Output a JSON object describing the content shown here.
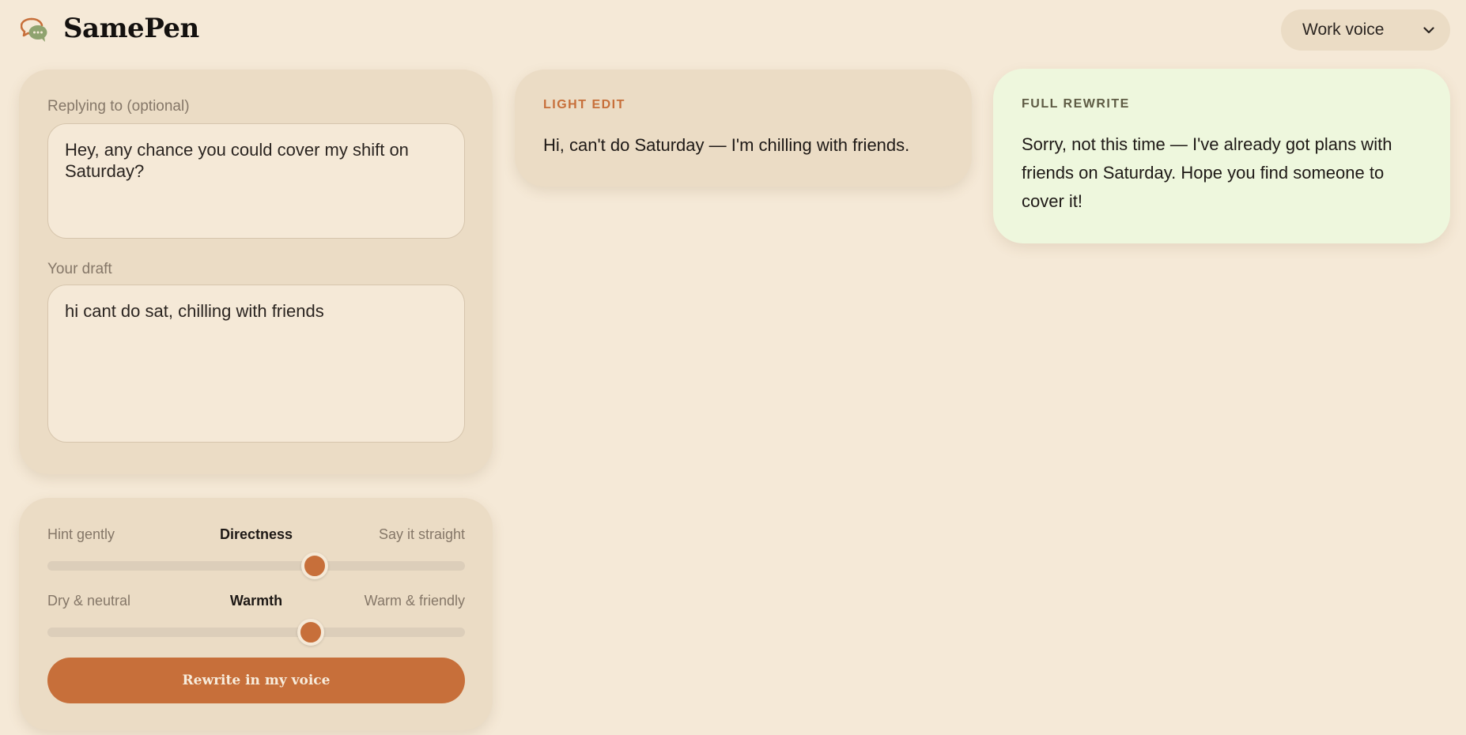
{
  "header": {
    "app_name": "SamePen",
    "logo_icon": "chat-bubbles-icon",
    "voice_select": {
      "selected": "Work voice",
      "icon": "chevron-down-icon"
    }
  },
  "input": {
    "reply_label": "Replying to (optional)",
    "reply_value": "Hey, any chance you could cover my shift on Saturday?",
    "draft_label": "Your draft",
    "draft_value": "hi cant do sat, chilling with friends"
  },
  "sliders": [
    {
      "left": "Hint gently",
      "name": "Directness",
      "right": "Say it straight",
      "value": 0.64
    },
    {
      "left": "Dry & neutral",
      "name": "Warmth",
      "right": "Warm & friendly",
      "value": 0.63
    }
  ],
  "action": {
    "rewrite_label": "Rewrite in my voice"
  },
  "results": {
    "light": {
      "title": "LIGHT EDIT",
      "text": "Hi, can't do Saturday — I'm chilling with friends."
    },
    "full": {
      "title": "FULL REWRITE",
      "text": "Sorry, not this time — I've already got plans with friends on Saturday. Hope you find someone to cover it!"
    }
  },
  "colors": {
    "background": "#f5e9d7",
    "card": "#ebdcc5",
    "accent": "#c76f3a",
    "full_rewrite_card": "#eef7dd"
  }
}
